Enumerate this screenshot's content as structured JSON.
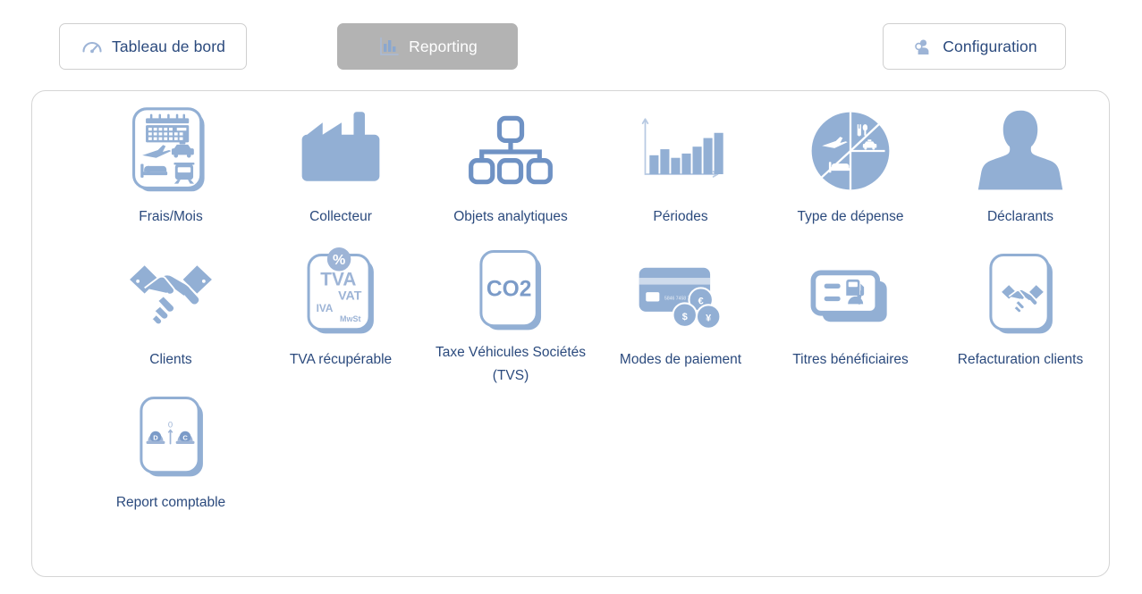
{
  "app": {
    "accent_blue": "#92AFD4",
    "label_color": "#2b4a7d",
    "active_tab_bg": "#b3b3b3",
    "panel_border": "#d5d5d5"
  },
  "tabs": [
    {
      "id": "dashboard",
      "label": "Tableau de bord",
      "icon": "gauge-icon",
      "active": false
    },
    {
      "id": "reporting",
      "label": "Reporting",
      "icon": "bar-chart-icon",
      "active": true
    },
    {
      "id": "configuration",
      "label": "Configuration",
      "icon": "user-gear-icon",
      "active": false
    }
  ],
  "reports": [
    {
      "id": "frais-mois",
      "label": "Frais/Mois",
      "icon": "calendar-travel-card-icon"
    },
    {
      "id": "collecteur",
      "label": "Collecteur",
      "icon": "factory-icon"
    },
    {
      "id": "objets-analytiques",
      "label": "Objets analytiques",
      "icon": "org-chart-icon"
    },
    {
      "id": "periodes",
      "label": "Périodes",
      "icon": "bar-chart-axes-icon"
    },
    {
      "id": "type-de-depense",
      "label": "Type de dépense",
      "icon": "pie-chart-expense-icon"
    },
    {
      "id": "declarants",
      "label": "Déclarants",
      "icon": "person-bust-icon"
    },
    {
      "id": "clients",
      "label": "Clients",
      "icon": "handshake-icon"
    },
    {
      "id": "tva-recuperable",
      "label": "TVA récupérable",
      "icon": "vat-card-icon"
    },
    {
      "id": "taxe-vehicules",
      "label": "Taxe Véhicules Sociétés (TVS)",
      "icon": "co2-card-icon"
    },
    {
      "id": "modes-de-paiement",
      "label": "Modes de paiement",
      "icon": "credit-card-coins-icon"
    },
    {
      "id": "titres-beneficiaires",
      "label": "Titres bénéficiaires",
      "icon": "voucher-cards-icon"
    },
    {
      "id": "refacturation",
      "label": "Refacturation clients",
      "icon": "handshake-card-icon"
    },
    {
      "id": "report-comptable",
      "label": "Report comptable",
      "icon": "balance-scale-card-icon"
    }
  ],
  "icon_text": {
    "vat_percent": "%",
    "vat_fr": "TVA",
    "vat_en": "VAT",
    "vat_it": "IVA",
    "vat_de": "MwSt",
    "co2": "CO2",
    "coin_eur": "€",
    "coin_usd": "$",
    "coin_jpy": "¥",
    "debit": "D",
    "credit": "C",
    "zero": "0"
  }
}
